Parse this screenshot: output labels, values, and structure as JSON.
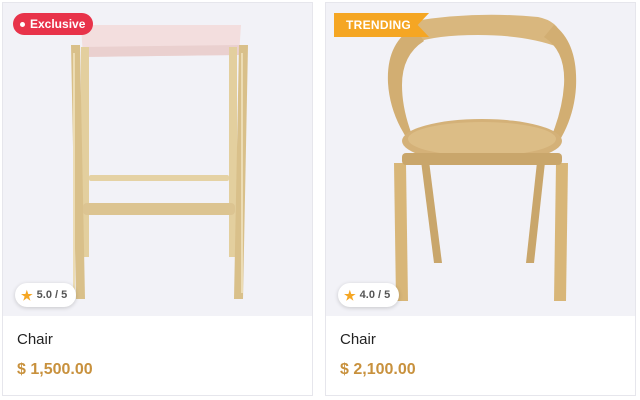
{
  "products": [
    {
      "badge": "Exclusive",
      "rating": "5.0 / 5",
      "name": "Chair",
      "price": "$ 1,500.00",
      "image_icon": "bar-stool-image"
    },
    {
      "badge": "TRENDING",
      "rating": "4.0 / 5",
      "name": "Chair",
      "price": "$ 2,100.00",
      "image_icon": "armchair-image"
    }
  ],
  "colors": {
    "exclusive_badge": "#e8334a",
    "trending_badge": "#f5a623",
    "price": "#c8913d",
    "star": "#f5a623"
  }
}
